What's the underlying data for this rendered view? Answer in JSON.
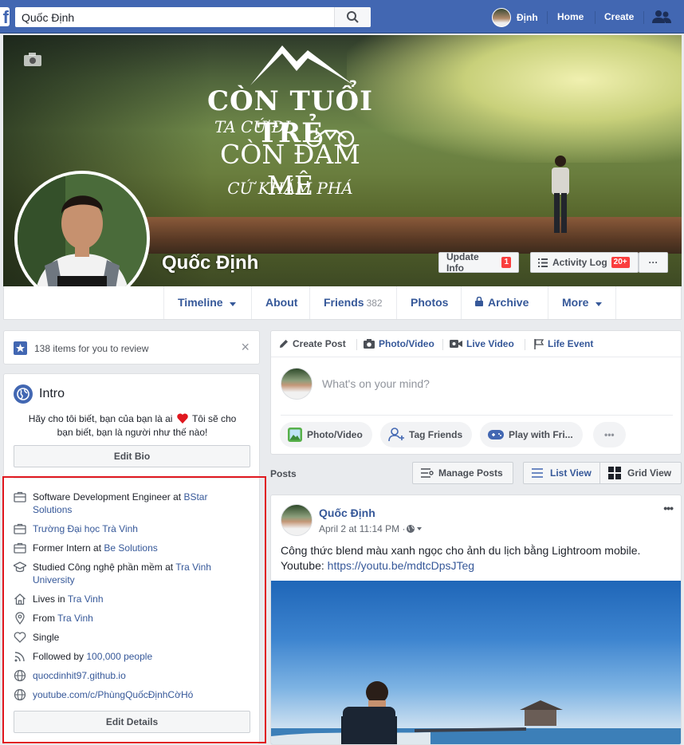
{
  "topbar": {
    "logo": "f",
    "search_value": "Quốc Định",
    "user_name": "Định",
    "home": "Home",
    "create": "Create"
  },
  "cover": {
    "quote_line1": "CÒN TUỔI TRẺ",
    "quote_line2": "TA CỨ ĐI",
    "quote_line3": "CÒN ĐAM MÊ",
    "quote_line4": "CỨ KHÁM PHÁ",
    "profile_name": "Quốc Định",
    "update_info": "Update Info",
    "update_info_badge": "1",
    "activity_log": "Activity Log",
    "activity_log_badge": "20+",
    "more_dots": "···"
  },
  "tabs": {
    "timeline": "Timeline",
    "about": "About",
    "friends": "Friends",
    "friends_count": "382",
    "photos": "Photos",
    "archive": "Archive",
    "more": "More"
  },
  "review": {
    "text": "138 items for you to review",
    "close": "×"
  },
  "intro": {
    "title": "Intro",
    "bio_line1": "Hãy cho tôi biết, bạn của bạn là ai",
    "bio_line1b": "Tôi sẽ cho",
    "bio_line2": "bạn biết, bạn là người như thế nào!",
    "edit_bio": "Edit Bio",
    "edit_details": "Edit Details",
    "details": {
      "work1_pre": "Software Development Engineer at ",
      "work1_link": "BStar",
      "work1_link2": "Solutions",
      "school1": "Trường Đại học Trà Vinh",
      "work2_pre": "Former Intern at ",
      "work2_link": "Be Solutions",
      "edu_pre": "Studied Công nghệ phần mềm at ",
      "edu_link": "Tra Vinh",
      "edu_link2": "University",
      "lives_pre": "Lives in ",
      "lives_link": "Tra Vinh",
      "from_pre": "From ",
      "from_link": "Tra Vinh",
      "relationship": "Single",
      "followed_pre": "Followed by ",
      "followed_link": "100,000 people",
      "website1": "quocdinhit97.github.io",
      "website2": "youtube.com/c/PhùngQuốcĐịnhCờHó"
    }
  },
  "composer": {
    "create_post": "Create Post",
    "photo_video": "Photo/Video",
    "live_video": "Live Video",
    "life_event": "Life Event",
    "placeholder": "What's on your mind?",
    "pill_photo": "Photo/Video",
    "pill_tag": "Tag Friends",
    "pill_play": "Play with Fri...",
    "pill_more": "•••"
  },
  "posts_header": {
    "label": "Posts",
    "manage": "Manage Posts",
    "list_view": "List View",
    "grid_view": "Grid View"
  },
  "post": {
    "author": "Quốc Định",
    "date": "April 2 at 11:14 PM · ",
    "text_line1": "Công thức blend màu xanh ngọc cho ảnh du lịch bằng Lightroom mobile.",
    "text_pre": "Youtube: ",
    "text_link": "https://youtu.be/mdtcDpsJTeg",
    "menu": "•••"
  },
  "colors": {
    "brand": "#4267b2",
    "link": "#365899",
    "badge": "#fa3e3e",
    "highlight_box": "#e0181f"
  }
}
